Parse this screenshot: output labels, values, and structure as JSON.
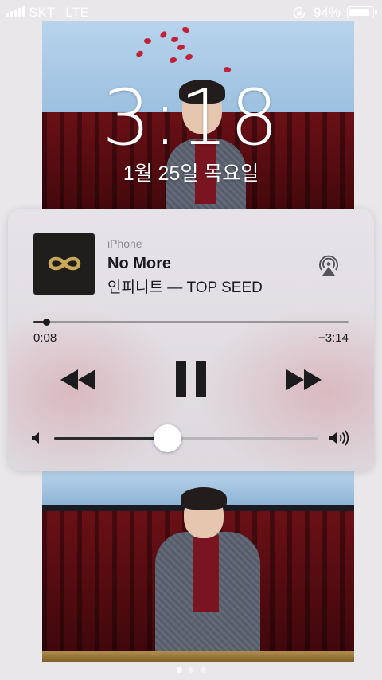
{
  "status_bar": {
    "carrier": "SKT",
    "network": "LTE",
    "battery_percent": "94%",
    "battery_level": 0.94,
    "icons": [
      "signal-bars-icon",
      "rotation-lock-icon",
      "battery-icon"
    ]
  },
  "lock_screen": {
    "time": "3:18",
    "date": "1월 25일 목요일",
    "page_indicator": {
      "count": 3,
      "active": 0
    }
  },
  "now_playing": {
    "source": "iPhone",
    "title": "No More",
    "subtitle": "인피니트 — TOP SEED",
    "elapsed": "0:08",
    "remaining": "−3:14",
    "progress": 0.04,
    "volume": 0.43,
    "icons": [
      "album-artwork-infinity-icon",
      "airplay-icon",
      "rewind-icon",
      "pause-icon",
      "fast-forward-icon",
      "volume-low-icon",
      "volume-high-icon"
    ]
  },
  "colors": {
    "card_background": "#e4e1e5",
    "text_primary": "#1c1c1e",
    "text_secondary": "#8c8890",
    "artwork_gold": "#c9a85a"
  }
}
